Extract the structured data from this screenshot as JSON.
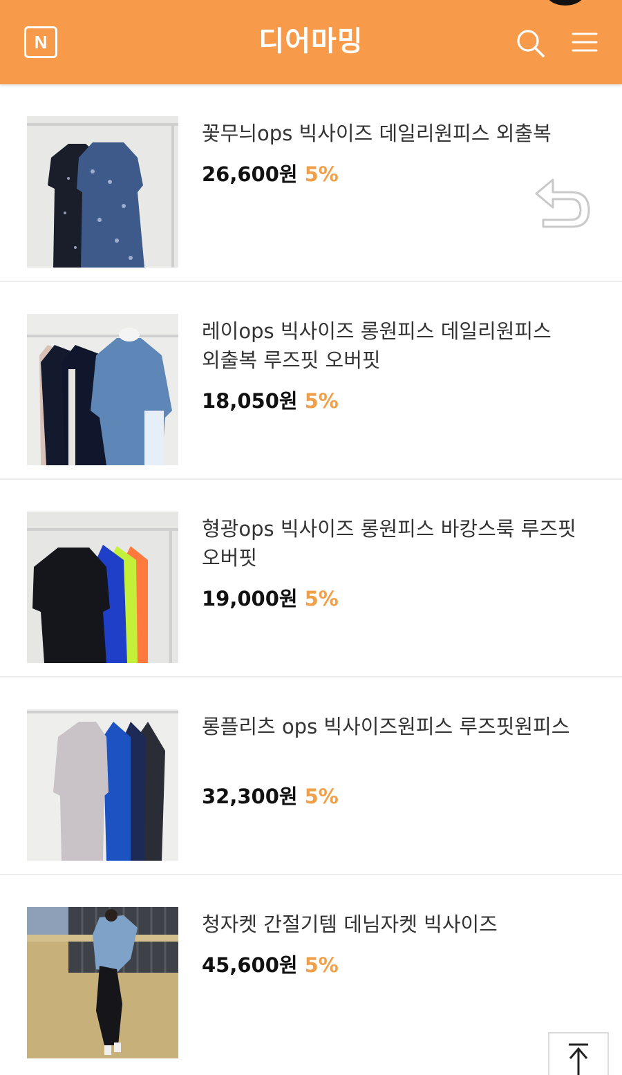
{
  "header": {
    "logo_letter": "N",
    "title": "디어마밍",
    "accent_color": "#f79a4a"
  },
  "products": [
    {
      "name": "꽃무늬ops 빅사이즈 데일리원피스 외출복",
      "price": "26,600원",
      "discount": "5%"
    },
    {
      "name": "레이ops 빅사이즈 롱원피스 데일리원피스 외출복 루즈핏 오버핏",
      "price": "18,050원",
      "discount": "5%"
    },
    {
      "name": "형광ops 빅사이즈 롱원피스 바캉스룩 루즈핏 오버핏",
      "price": "19,000원",
      "discount": "5%"
    },
    {
      "name": "롱플리츠 ops 빅사이즈원피스 루즈핏원피스",
      "price": "32,300원",
      "discount": "5%"
    },
    {
      "name": "청자켓 간절기템 데님자켓 빅사이즈",
      "price": "45,600원",
      "discount": "5%"
    }
  ],
  "icons": {
    "logo": "naver-logo-icon",
    "search": "search-icon",
    "menu": "hamburger-menu-icon",
    "back": "back-arrow-icon",
    "top": "scroll-to-top-icon"
  }
}
